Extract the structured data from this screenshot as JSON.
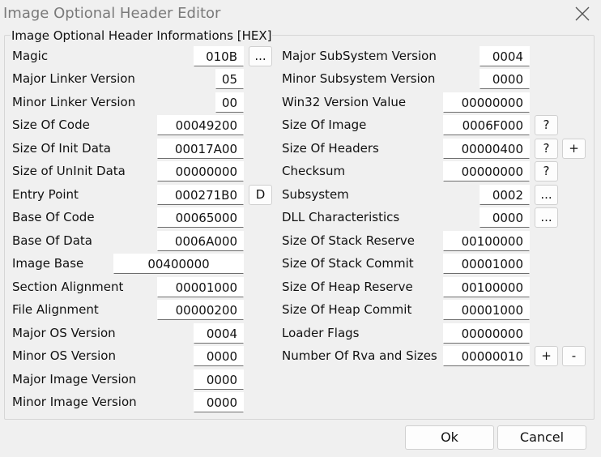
{
  "window": {
    "title": "Image Optional Header Editor",
    "close_icon": "close-icon"
  },
  "group": {
    "title": "Image Optional Header Informations [HEX]"
  },
  "left": [
    {
      "label": "Magic",
      "value": "010B"
    },
    {
      "label": "Major Linker Version",
      "value": "05"
    },
    {
      "label": "Minor Linker Version",
      "value": "00"
    },
    {
      "label": "Size Of Code",
      "value": "00049200"
    },
    {
      "label": "Size Of Init Data",
      "value": "00017A00"
    },
    {
      "label": "Size of UnInit Data",
      "value": "00000000"
    },
    {
      "label": "Entry Point",
      "value": "000271B0"
    },
    {
      "label": "Base Of Code",
      "value": "00065000"
    },
    {
      "label": "Base Of Data",
      "value": "0006A000"
    },
    {
      "label": "Image Base",
      "value": "00400000"
    },
    {
      "label": "Section Alignment",
      "value": "00001000"
    },
    {
      "label": "File Alignment",
      "value": "00000200"
    },
    {
      "label": "Major OS Version",
      "value": "0004"
    },
    {
      "label": "Minor OS Version",
      "value": "0000"
    },
    {
      "label": "Major Image Version",
      "value": "0000"
    },
    {
      "label": "Minor Image Version",
      "value": "0000"
    }
  ],
  "right": [
    {
      "label": "Major SubSystem Version",
      "value": "0004"
    },
    {
      "label": "Minor Subsystem Version",
      "value": "0000"
    },
    {
      "label": "Win32 Version Value",
      "value": "00000000"
    },
    {
      "label": "Size Of Image",
      "value": "0006F000"
    },
    {
      "label": "Size Of Headers",
      "value": "00000400"
    },
    {
      "label": "Checksum",
      "value": "00000000"
    },
    {
      "label": "Subsystem",
      "value": "0002"
    },
    {
      "label": "DLL Characteristics",
      "value": "0000"
    },
    {
      "label": "Size Of Stack Reserve",
      "value": "00100000"
    },
    {
      "label": "Size Of Stack Commit",
      "value": "00001000"
    },
    {
      "label": "Size Of Heap Reserve",
      "value": "00100000"
    },
    {
      "label": "Size Of Heap Commit",
      "value": "00001000"
    },
    {
      "label": "Loader Flags",
      "value": "00000000"
    },
    {
      "label": "Number Of Rva and Sizes",
      "value": "00000010"
    }
  ],
  "buttons": {
    "magic_more": "...",
    "entry_disasm": "D",
    "size_of_image_help": "?",
    "size_of_headers_help": "?",
    "size_of_headers_add": "+",
    "checksum_help": "?",
    "subsystem_more": "...",
    "dll_more": "...",
    "rva_add": "+",
    "rva_remove": "-",
    "ok": "Ok",
    "cancel": "Cancel"
  }
}
